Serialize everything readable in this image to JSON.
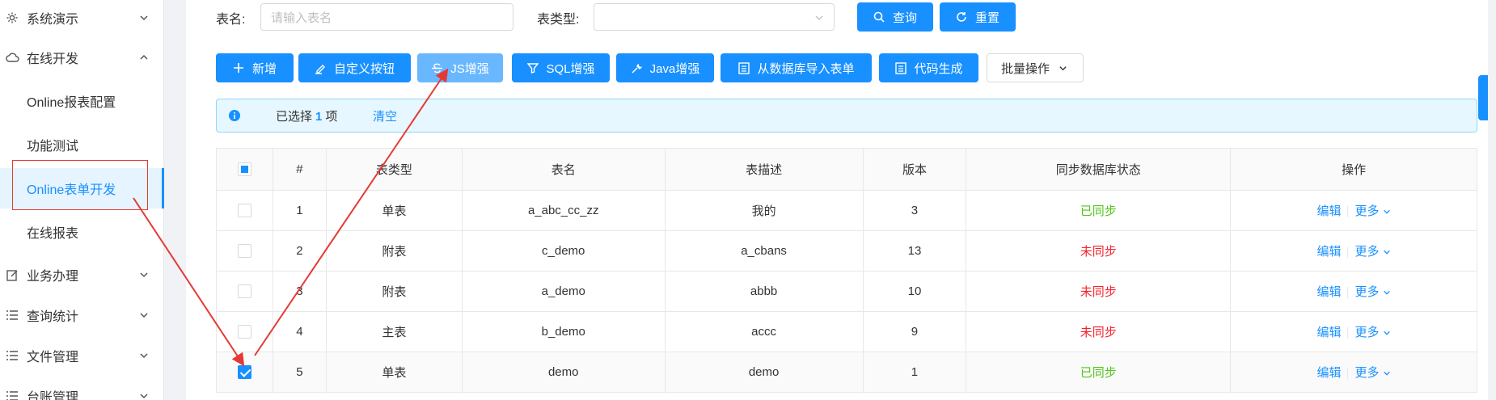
{
  "sidebar": {
    "items": [
      {
        "label": "系统演示",
        "icon": "gear-icon",
        "expanded": false
      },
      {
        "label": "在线开发",
        "icon": "cloud-icon",
        "expanded": true
      },
      {
        "label": "业务办理",
        "icon": "edit-icon",
        "expanded": false
      },
      {
        "label": "查询统计",
        "icon": "list-icon",
        "expanded": false
      },
      {
        "label": "文件管理",
        "icon": "list-icon",
        "expanded": false
      },
      {
        "label": "台账管理",
        "icon": "list-icon",
        "expanded": false
      }
    ],
    "submenu": [
      {
        "label": "Online报表配置"
      },
      {
        "label": "功能测试"
      },
      {
        "label": "Online表单开发",
        "active": true
      },
      {
        "label": "在线报表"
      }
    ]
  },
  "search": {
    "table_name_label": "表名:",
    "table_name_placeholder": "请输入表名",
    "table_type_label": "表类型:",
    "table_type_value": "",
    "query_button": "查询",
    "reset_button": "重置"
  },
  "toolbar": {
    "add": "新增",
    "custom_button": "自定义按钮",
    "js_enhance": "JS增强",
    "sql_enhance": "SQL增强",
    "java_enhance": "Java增强",
    "import_db": "从数据库导入表单",
    "code_gen": "代码生成",
    "batch": "批量操作"
  },
  "alert": {
    "prefix": "已选择",
    "count": "1",
    "suffix": "项",
    "clear": "清空"
  },
  "table": {
    "columns": [
      "#",
      "表类型",
      "表名",
      "表描述",
      "版本",
      "同步数据库状态",
      "操作"
    ],
    "rows": [
      {
        "index": "1",
        "type": "单表",
        "name": "a_abc_cc_zz",
        "desc": "我的",
        "version": "3",
        "status": "已同步",
        "synced": true,
        "checked": false
      },
      {
        "index": "2",
        "type": "附表",
        "name": "c_demo",
        "desc": "a_cbans",
        "version": "13",
        "status": "未同步",
        "synced": false,
        "checked": false
      },
      {
        "index": "3",
        "type": "附表",
        "name": "a_demo",
        "desc": "abbb",
        "version": "10",
        "status": "未同步",
        "synced": false,
        "checked": false
      },
      {
        "index": "4",
        "type": "主表",
        "name": "b_demo",
        "desc": "accc",
        "version": "9",
        "status": "未同步",
        "synced": false,
        "checked": false
      },
      {
        "index": "5",
        "type": "单表",
        "name": "demo",
        "desc": "demo",
        "version": "1",
        "status": "已同步",
        "synced": true,
        "checked": true
      }
    ],
    "edit_label": "编辑",
    "more_label": "更多"
  },
  "colors": {
    "primary": "#1890ff",
    "success": "#52c41a",
    "danger": "#f5222d",
    "annotation": "#e53935"
  }
}
